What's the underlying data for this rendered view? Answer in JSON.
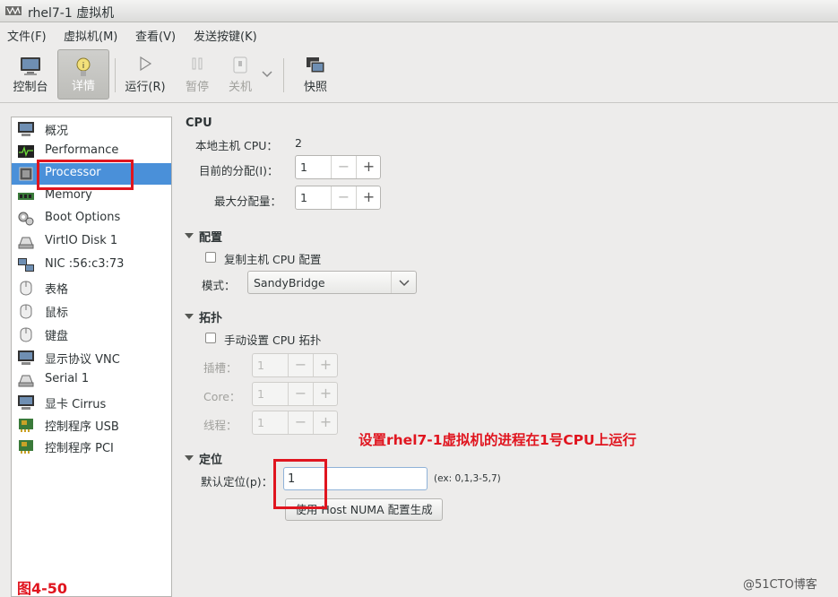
{
  "window": {
    "title": "rhel7-1 虚拟机"
  },
  "menu": [
    "文件(F)",
    "虚拟机(M)",
    "查看(V)",
    "发送按键(K)"
  ],
  "toolbar": {
    "console": "控制台",
    "details": "详情",
    "run": "运行(R)",
    "pause": "暂停",
    "shutdown": "关机",
    "snapshot": "快照"
  },
  "sidebar": {
    "items": [
      {
        "label": "概况",
        "icon": "monitor-icon"
      },
      {
        "label": "Performance",
        "icon": "performance-icon"
      },
      {
        "label": "Processor",
        "icon": "processor-icon"
      },
      {
        "label": "Memory",
        "icon": "memory-icon"
      },
      {
        "label": "Boot Options",
        "icon": "gears-icon"
      },
      {
        "label": "VirtIO Disk 1",
        "icon": "disk-icon"
      },
      {
        "label": "NIC :56:c3:73",
        "icon": "network-icon"
      },
      {
        "label": "表格",
        "icon": "tablet-icon"
      },
      {
        "label": "鼠标",
        "icon": "mouse-icon"
      },
      {
        "label": "键盘",
        "icon": "keyboard-icon"
      },
      {
        "label": "显示协议 VNC",
        "icon": "display-icon"
      },
      {
        "label": "Serial 1",
        "icon": "serial-icon"
      },
      {
        "label": "显卡 Cirrus",
        "icon": "video-card-icon"
      },
      {
        "label": "控制程序 USB",
        "icon": "controller-icon"
      },
      {
        "label": "控制程序 PCI",
        "icon": "controller-icon"
      }
    ],
    "selected": 2
  },
  "cpu": {
    "title": "CPU",
    "host_cpu_label": "本地主机 CPU：",
    "host_cpu_value": "2",
    "current_label": "目前的分配(I)：",
    "current_value": "1",
    "max_label": "最大分配量：",
    "max_value": "1"
  },
  "config": {
    "title": "配置",
    "copy_host_label": "复制主机 CPU 配置",
    "copy_host_checked": false,
    "model_label": "模式：",
    "model_value": "SandyBridge"
  },
  "topology": {
    "title": "拓扑",
    "manual_label": "手动设置 CPU 拓扑",
    "manual_checked": false,
    "sockets_label": "插槽：",
    "sockets_value": "1",
    "cores_label": "Core：",
    "cores_value": "1",
    "threads_label": "线程：",
    "threads_value": "1"
  },
  "pinning": {
    "title": "定位",
    "default_label": "默认定位(p)：",
    "default_value": "1",
    "example": "(ex: 0,1,3-5,7)",
    "numa_button": "使用 Host NUMA 配置生成"
  },
  "annotation": "设置rhel7-1虚拟机的进程在1号CPU上运行",
  "figure_label": "图4-50",
  "watermark": "@51CTO博客",
  "colors": {
    "selection": "#4a90d9",
    "annotation": "#e0151f"
  }
}
